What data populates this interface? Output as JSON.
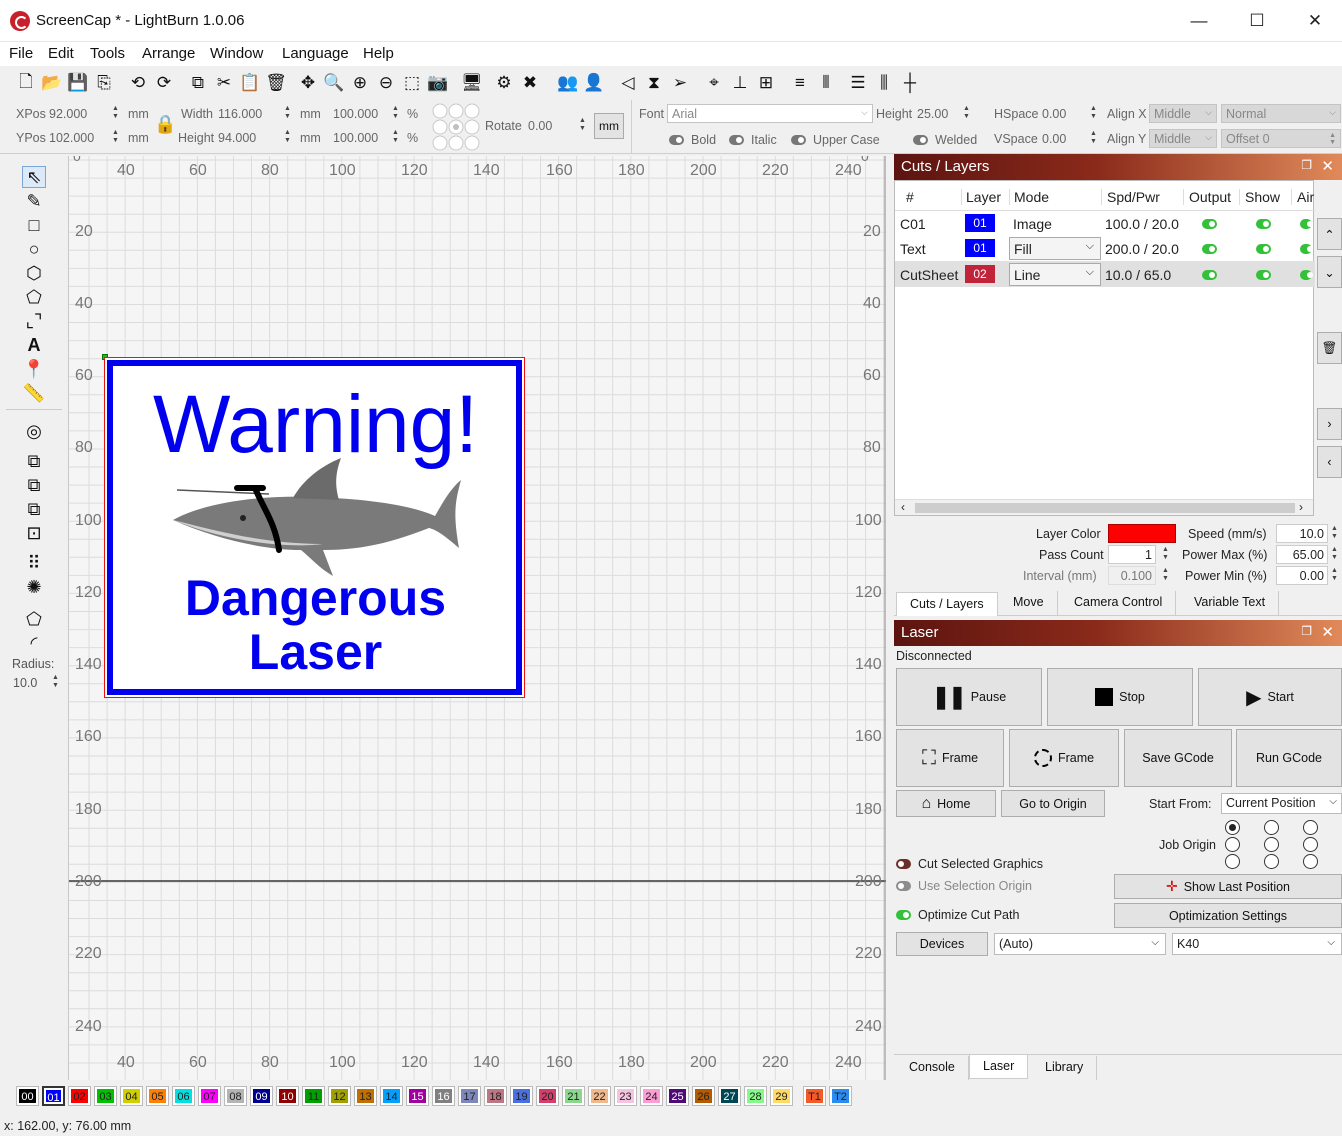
{
  "window": {
    "title": "ScreenCap * - LightBurn 1.0.06",
    "minimize": "—",
    "maximize": "☐",
    "close": "✕"
  },
  "menu": [
    "File",
    "Edit",
    "Tools",
    "Arrange",
    "Window",
    "Language",
    "Help"
  ],
  "props": {
    "xpos_label": "XPos",
    "xpos": "92.000",
    "ypos_label": "YPos",
    "ypos": "102.000",
    "unit": "mm",
    "width_label": "Width",
    "width": "116.000",
    "height_label": "Height",
    "height": "94.000",
    "scale_w": "100.000",
    "scale_h": "100.000",
    "percent": "%",
    "rotate_label": "Rotate",
    "rotate": "0.00",
    "mm_button": "mm",
    "font_label": "Font",
    "font": "Arial",
    "text_height_label": "Height",
    "text_height": "25.00",
    "hspace_label": "HSpace",
    "hspace": "0.00",
    "vspace_label": "VSpace",
    "vspace": "0.00",
    "alignx_label": "Align X",
    "alignx": "Middle",
    "aligny_label": "Align Y",
    "aligny": "Middle",
    "normal": "Normal",
    "offset": "Offset 0",
    "bold": "Bold",
    "italic": "Italic",
    "upper": "Upper Case",
    "welded": "Welded"
  },
  "tools": {
    "radius_label": "Radius:",
    "radius": "10.0"
  },
  "ruler": {
    "x": [
      "40",
      "60",
      "80",
      "100",
      "120",
      "140",
      "160",
      "180",
      "200",
      "220",
      "240"
    ],
    "y": [
      "20",
      "40",
      "60",
      "80",
      "100",
      "120",
      "140",
      "160",
      "180",
      "200",
      "220",
      "240"
    ],
    "top_zero": "0"
  },
  "design": {
    "title": "Warning!",
    "line1": "Dangerous",
    "line2": "Laser"
  },
  "cuts": {
    "title": "Cuts / Layers",
    "headers": [
      "#",
      "Layer",
      "Mode",
      "Spd/Pwr",
      "Output",
      "Show",
      "Air"
    ],
    "rows": [
      {
        "name": "C01",
        "layer": "01",
        "mode": "Image",
        "spdpwr": "100.0 / 20.0"
      },
      {
        "name": "Text",
        "layer": "01",
        "mode": "Fill",
        "spdpwr": "200.0 / 20.0"
      },
      {
        "name": "CutSheet",
        "layer": "02",
        "mode": "Line",
        "spdpwr": "10.0 / 65.0"
      }
    ],
    "layer_color_label": "Layer Color",
    "pass_count_label": "Pass Count",
    "pass_count": "1",
    "interval_label": "Interval (mm)",
    "interval": "0.100",
    "speed_label": "Speed (mm/s)",
    "speed": "10.0",
    "power_max_label": "Power Max (%)",
    "power_max": "65.00",
    "power_min_label": "Power Min (%)",
    "power_min": "0.00",
    "tabs": [
      "Cuts / Layers",
      "Move",
      "Camera Control",
      "Variable Text"
    ]
  },
  "laser": {
    "title": "Laser",
    "status": "Disconnected",
    "pause": "Pause",
    "stop": "Stop",
    "start": "Start",
    "frame1": "Frame",
    "frame2": "Frame",
    "save_gcode": "Save GCode",
    "run_gcode": "Run GCode",
    "home": "Home",
    "go_origin": "Go to Origin",
    "start_from_label": "Start From:",
    "start_from": "Current Position",
    "job_origin_label": "Job Origin",
    "cut_selected": "Cut Selected Graphics",
    "use_selection": "Use Selection Origin",
    "optimize": "Optimize Cut Path",
    "show_last": "Show Last Position",
    "opt_settings": "Optimization Settings",
    "devices": "Devices",
    "port": "(Auto)",
    "device": "K40",
    "bottom_tabs": [
      "Console",
      "Laser",
      "Library"
    ]
  },
  "palette": [
    {
      "label": "00",
      "color": "#000000"
    },
    {
      "label": "01",
      "color": "#0000ff"
    },
    {
      "label": "02",
      "color": "#ff0000"
    },
    {
      "label": "03",
      "color": "#00c000"
    },
    {
      "label": "04",
      "color": "#d0d000"
    },
    {
      "label": "05",
      "color": "#ff8000"
    },
    {
      "label": "06",
      "color": "#00e0e0"
    },
    {
      "label": "07",
      "color": "#ff00ff"
    },
    {
      "label": "08",
      "color": "#b4b4b4"
    },
    {
      "label": "09",
      "color": "#000090"
    },
    {
      "label": "10",
      "color": "#900000"
    },
    {
      "label": "11",
      "color": "#00a000"
    },
    {
      "label": "12",
      "color": "#a0a000"
    },
    {
      "label": "13",
      "color": "#c07000"
    },
    {
      "label": "14",
      "color": "#00a0ff"
    },
    {
      "label": "15",
      "color": "#a000a0"
    },
    {
      "label": "16",
      "color": "#808080"
    },
    {
      "label": "17",
      "color": "#7d87b9"
    },
    {
      "label": "18",
      "color": "#bb7784"
    },
    {
      "label": "19",
      "color": "#4a6fe3"
    },
    {
      "label": "20",
      "color": "#d33f6a"
    },
    {
      "label": "21",
      "color": "#8cd78e"
    },
    {
      "label": "22",
      "color": "#f0b98d"
    },
    {
      "label": "23",
      "color": "#f6c4e1"
    },
    {
      "label": "24",
      "color": "#fa9ed4"
    },
    {
      "label": "25",
      "color": "#500a78"
    },
    {
      "label": "26",
      "color": "#b45a00"
    },
    {
      "label": "27",
      "color": "#004754"
    },
    {
      "label": "28",
      "color": "#86fa88"
    },
    {
      "label": "29",
      "color": "#ffdb66"
    },
    {
      "label": "T1",
      "color": "#f35a28"
    },
    {
      "label": "T2",
      "color": "#2a8cf0"
    }
  ],
  "status": {
    "coords": "x: 162.00, y: 76.00 mm"
  }
}
